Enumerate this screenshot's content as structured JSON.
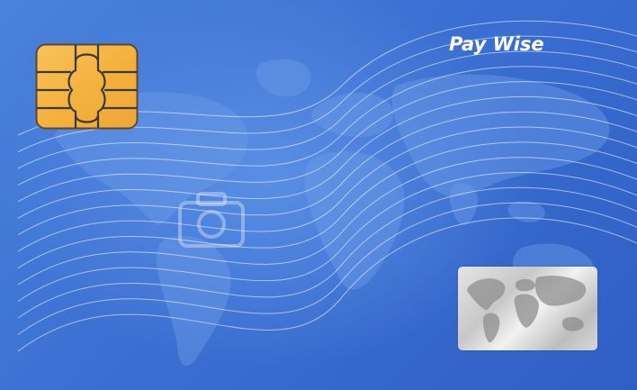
{
  "card": {
    "brand_name": "Pay Wise"
  },
  "colors": {
    "card_background": "#3b70d2",
    "card_highlight": "#5a8fe4",
    "chip_gold": "#f6b544",
    "chip_outline": "#3a3a3a",
    "hologram_silver": "#d0d0d0",
    "brand_text": "#ffffff"
  },
  "icons": {
    "chip": "emv-chip-icon",
    "map": "world-map-icon",
    "hologram": "hologram-icon",
    "watermark": "camera-watermark-icon"
  }
}
